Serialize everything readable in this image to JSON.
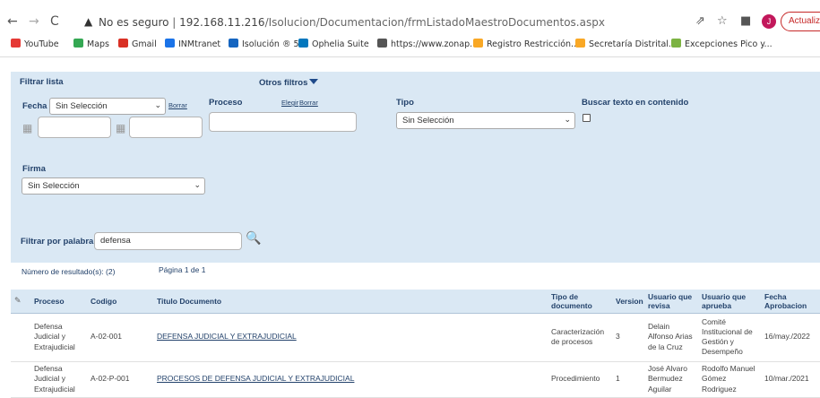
{
  "browser": {
    "security_label": "No es seguro",
    "url_host": "192.168.11.216",
    "url_path": "/Isolucion/Documentacion/frmListadoMaestroDocumentos.aspx",
    "avatar_letter": "J",
    "update_label": "Actualizar",
    "bookmarks": [
      {
        "label": "YouTube",
        "color": "#e53935"
      },
      {
        "label": "Maps",
        "color": "#34a853"
      },
      {
        "label": "Gmail",
        "color": "#d93025"
      },
      {
        "label": "INMtranet",
        "color": "#1a73e8"
      },
      {
        "label": "Isolución ® 5",
        "color": "#1565c0"
      },
      {
        "label": "Ophelia Suite",
        "color": "#0277bd"
      },
      {
        "label": "https://www.zonap...",
        "color": "#555555"
      },
      {
        "label": "Registro Restricción...",
        "color": "#f9a825"
      },
      {
        "label": "Secretaría Distrital...",
        "color": "#f9a825"
      },
      {
        "label": "Excepciones Pico y...",
        "color": "#7cb342"
      }
    ]
  },
  "filters": {
    "title": "Filtrar lista",
    "more_filters": "Otros filtros",
    "fecha_label": "Fecha",
    "fecha_value": "Sin Selección",
    "fecha_clear": "Borrar",
    "proceso_label": "Proceso",
    "proceso_search": "Elegir",
    "proceso_clear": "Borrar",
    "tipo_label": "Tipo",
    "tipo_value": "Sin Selección",
    "buscar_label": "Buscar texto en contenido",
    "firma_label": "Firma",
    "firma_value": "Sin Selección",
    "palabra_label": "Filtrar por palabra",
    "palabra_value": "defensa"
  },
  "summary": {
    "results": "Número de resultado(s): (2)",
    "page": "Página 1 de 1"
  },
  "table": {
    "headers": [
      "Proceso",
      "Codigo",
      "Titulo Documento",
      "Tipo de documento",
      "Version",
      "Usuario que revisa",
      "Usuario que aprueba",
      "Fecha Aprobacion"
    ],
    "rows": [
      {
        "proceso": "Defensa Judicial y Extrajudicial",
        "codigo": "A-02-001",
        "titulo": "DEFENSA JUDICIAL Y EXTRAJUDICIAL",
        "tipo": "Caracterización de procesos",
        "version": "3",
        "revisa": "Delain Alfonso Arias de la Cruz",
        "aprueba": "Comité Institucional de Gestión y Desempeño",
        "fecha": "16/may./2022"
      },
      {
        "proceso": "Defensa Judicial y Extrajudicial",
        "codigo": "A-02-P-001",
        "titulo": "PROCESOS DE DEFENSA JUDICIAL Y EXTRAJUDICIAL",
        "tipo": "Procedimiento",
        "version": "1",
        "revisa": "José Alvaro Bermudez Aguilar",
        "aprueba": "Rodolfo Manuel Gómez Rodriguez",
        "fecha": "10/mar./2021"
      }
    ]
  }
}
